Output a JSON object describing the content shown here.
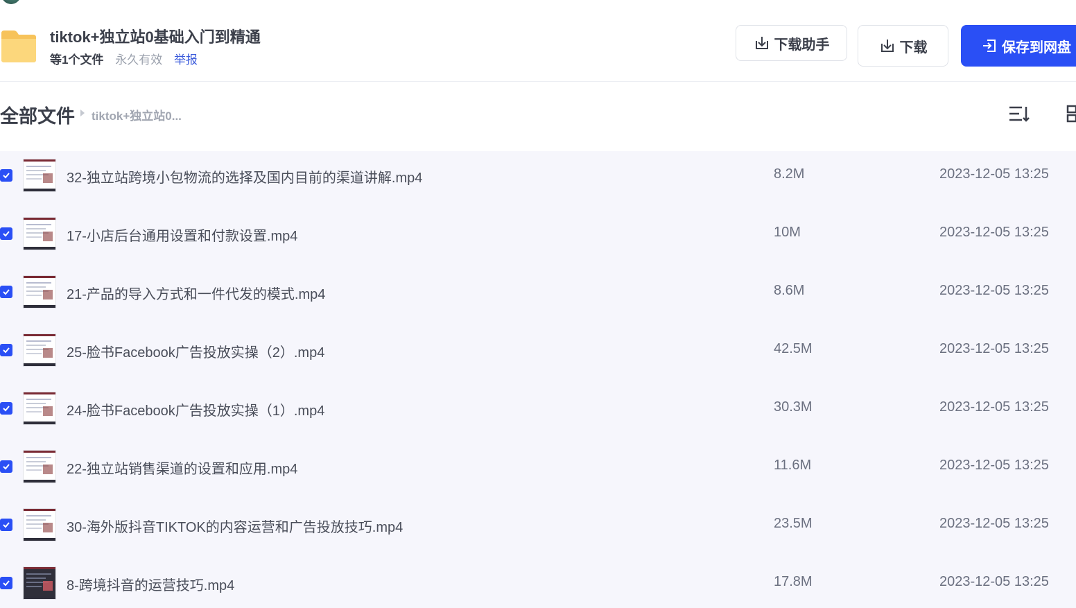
{
  "header": {
    "title": "tiktok+独立站0基础入门到精通",
    "file_count": "等1个文件",
    "validity": "永久有效",
    "report_link": "举报",
    "buttons": {
      "helper": "下载助手",
      "download": "下载",
      "save": "保存到网盘"
    }
  },
  "breadcrumb": {
    "root": "全部文件",
    "current": "tiktok+独立站0..."
  },
  "colors": {
    "accent": "#2a4ff5",
    "link": "#3b5bdb",
    "list_bg": "#f6f6fc"
  },
  "files": [
    {
      "name": "32-独立站跨境小包物流的选择及国内目前的渠道讲解.mp4",
      "size": "8.2M",
      "date": "2023-12-05 13:25",
      "checked": true
    },
    {
      "name": "17-小店后台通用设置和付款设置.mp4",
      "size": "10M",
      "date": "2023-12-05 13:25",
      "checked": true
    },
    {
      "name": "21-产品的导入方式和一件代发的模式.mp4",
      "size": "8.6M",
      "date": "2023-12-05 13:25",
      "checked": true
    },
    {
      "name": "25-脸书Facebook广告投放实操（2）.mp4",
      "size": "42.5M",
      "date": "2023-12-05 13:25",
      "checked": true
    },
    {
      "name": "24-脸书Facebook广告投放实操（1）.mp4",
      "size": "30.3M",
      "date": "2023-12-05 13:25",
      "checked": true
    },
    {
      "name": "22-独立站销售渠道的设置和应用.mp4",
      "size": "11.6M",
      "date": "2023-12-05 13:25",
      "checked": true
    },
    {
      "name": "30-海外版抖音TIKTOK的内容运营和广告投放技巧.mp4",
      "size": "23.5M",
      "date": "2023-12-05 13:25",
      "checked": true
    },
    {
      "name": "8-跨境抖音的运营技巧.mp4",
      "size": "17.8M",
      "date": "2023-12-05 13:25",
      "checked": true
    }
  ]
}
